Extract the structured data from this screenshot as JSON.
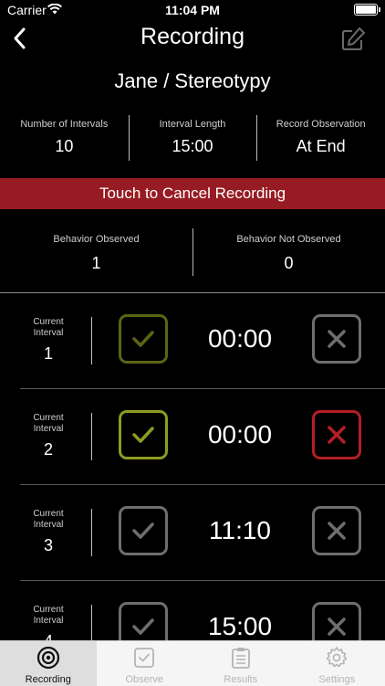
{
  "status_bar": {
    "carrier": "Carrier",
    "time": "11:04 PM"
  },
  "nav": {
    "title": "Recording"
  },
  "subtitle": "Jane / Stereotypy",
  "info": {
    "intervals_label": "Number of Intervals",
    "intervals_value": "10",
    "length_label": "Interval Length",
    "length_value": "15:00",
    "record_label": "Record Observation",
    "record_value": "At End"
  },
  "cancel_label": "Touch to Cancel Recording",
  "observed": {
    "observed_label": "Behavior Observed",
    "observed_value": "1",
    "not_observed_label": "Behavior Not Observed",
    "not_observed_value": "0"
  },
  "intervals": [
    {
      "label": "Current Interval",
      "number": "1",
      "time": "00:00",
      "check_state": "dim",
      "x_state": "neutral"
    },
    {
      "label": "Current Interval",
      "number": "2",
      "time": "00:00",
      "check_state": "selected",
      "x_state": "red"
    },
    {
      "label": "Current Interval",
      "number": "3",
      "time": "11:10",
      "check_state": "neutral",
      "x_state": "neutral"
    },
    {
      "label": "Current Interval",
      "number": "4",
      "time": "15:00",
      "check_state": "neutral",
      "x_state": "neutral"
    }
  ],
  "colors": {
    "cancel_bg": "#971b23",
    "check_dim": "#5c6414",
    "check_selected": "#8d9c21",
    "neutral": "#6e6e6e",
    "x_red": "#b41e24"
  },
  "tabs": [
    {
      "label": "Recording",
      "icon": "target-icon",
      "active": true
    },
    {
      "label": "Observe",
      "icon": "checkbox-icon",
      "active": false
    },
    {
      "label": "Results",
      "icon": "clipboard-icon",
      "active": false
    },
    {
      "label": "Settings",
      "icon": "gear-icon",
      "active": false
    }
  ]
}
